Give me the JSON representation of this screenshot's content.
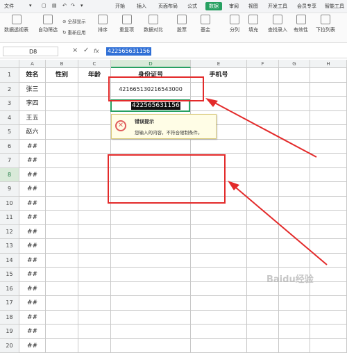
{
  "menubar": {
    "items": [
      "文件",
      "开始",
      "插入",
      "页面布局",
      "公式",
      "数据",
      "审阅",
      "视图",
      "开发工具",
      "会员专享",
      "智能工具"
    ],
    "active": "数据"
  },
  "ribbon": {
    "buttons": [
      "数据透视表",
      "自动筛选",
      "全部显示",
      "重新应用",
      "排序",
      "重复项",
      "数据对比",
      "股票",
      "基金",
      "分列",
      "填充",
      "查找录入",
      "有效性",
      "下拉列表"
    ]
  },
  "formula_bar": {
    "cell_ref": "D8",
    "cancel_icon": "×",
    "confirm_icon": "✓",
    "fx_label": "fx",
    "value": "422565631156"
  },
  "columns": [
    "A",
    "B",
    "C",
    "D",
    "E",
    "F",
    "G",
    "H"
  ],
  "header_row": [
    "姓名",
    "性别",
    "年龄",
    "身份证号",
    "手机号",
    "",
    "",
    ""
  ],
  "rows": [
    {
      "num": "1"
    },
    {
      "num": "2",
      "name": "张三",
      "id": "421665130216543000"
    },
    {
      "num": "3",
      "name": "李四"
    },
    {
      "num": "4",
      "name": "王五"
    },
    {
      "num": "5",
      "name": "赵六"
    },
    {
      "num": "6",
      "name": "##"
    },
    {
      "num": "7",
      "name": "##"
    },
    {
      "num": "8",
      "name": "##"
    },
    {
      "num": "9",
      "name": "##"
    },
    {
      "num": "10",
      "name": "##"
    },
    {
      "num": "11",
      "name": "##"
    },
    {
      "num": "12",
      "name": "##"
    },
    {
      "num": "13",
      "name": "##"
    },
    {
      "num": "14",
      "name": "##"
    },
    {
      "num": "15",
      "name": "##"
    },
    {
      "num": "16",
      "name": "##"
    },
    {
      "num": "17",
      "name": "##"
    },
    {
      "num": "18",
      "name": "##"
    },
    {
      "num": "19",
      "name": "##"
    },
    {
      "num": "20",
      "name": "##"
    }
  ],
  "editing_value": "422565631156",
  "error_popup": {
    "title": "错误提示",
    "message": "您输入的内容，不符合限制条件。"
  },
  "colors": {
    "accent": "#27a061",
    "annotation_red": "#e32a2a"
  },
  "watermark": "Baidu经验"
}
